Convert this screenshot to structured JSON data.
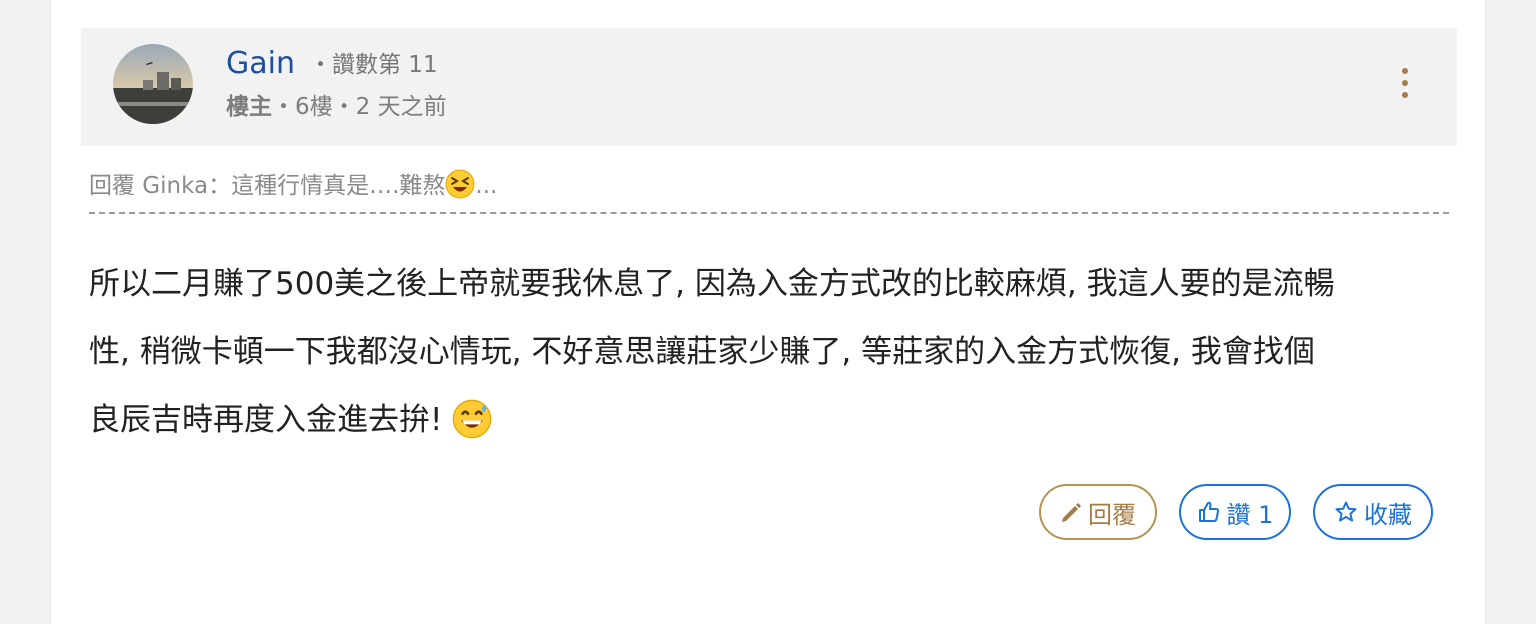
{
  "post": {
    "author": "Gain",
    "like_rank": "・讚數第 11",
    "role": "樓主",
    "floor": "・6樓・",
    "time": "2 天之前",
    "reply_ref": {
      "prefix": "回覆 Ginka：這種行情真是….難熬",
      "emoji": "laughing-emoji",
      "suffix": "..."
    },
    "body": {
      "line1": "所以二月賺了500美之後上帝就要我休息了, 因為入金方式改的比較麻煩, 我這人要的是流暢",
      "line2": "性, 稍微卡頓一下我都沒心情玩, 不好意思讓莊家少賺了, 等莊家的入金方式恢復, 我會找個",
      "line3": "良辰吉時再度入金進去拚!",
      "emoji": "grinning-sweat-emoji"
    }
  },
  "actions": {
    "reply_label": "回覆",
    "like_label": "讚 1",
    "fav_label": "收藏"
  },
  "colors": {
    "link_blue": "#1a73d6",
    "username_blue": "#1f4e9c",
    "gold": "#a57c47",
    "header_bg": "#f2f2f2"
  },
  "icons": {
    "menu": "kebab-icon",
    "reply": "pencil-icon",
    "like": "thumbs-up-icon",
    "fav": "star-icon"
  }
}
